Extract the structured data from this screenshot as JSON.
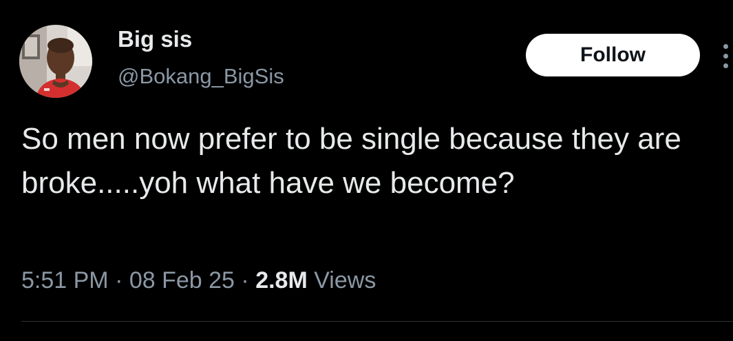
{
  "user": {
    "display_name": "Big sis",
    "handle": "@Bokang_BigSis"
  },
  "follow_label": "Follow",
  "more_icon": "more-vertical-icon",
  "tweet": {
    "text": "So men now prefer to be single because they are broke.....yoh what have we become?"
  },
  "meta": {
    "time": "5:51 PM",
    "separator": " · ",
    "date": "08 Feb 25",
    "views_count": "2.8M",
    "views_label": "Views"
  },
  "colors": {
    "background": "#000000",
    "primary_text": "#e7e9ea",
    "secondary_text": "#8b98a5",
    "follow_bg": "#ffffff",
    "follow_text": "#0f1419"
  }
}
